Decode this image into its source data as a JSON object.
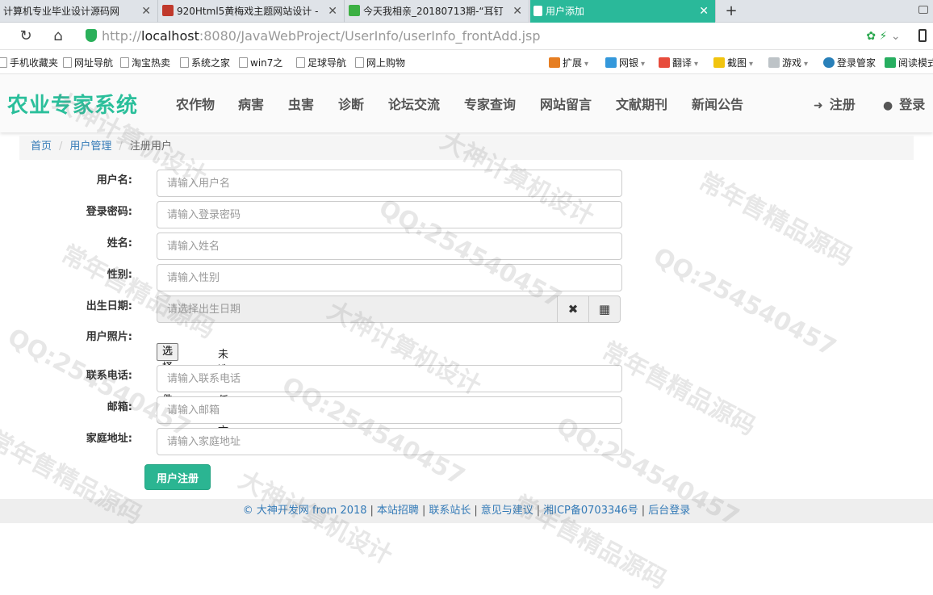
{
  "browser": {
    "tabs": [
      {
        "title": "计算机专业毕业设计源码网",
        "favicon_color": "#e8e8e8"
      },
      {
        "title": "920Html5黄梅戏主题网站设计 -",
        "favicon_color": "#c0392b"
      },
      {
        "title": "今天我相亲_20180713期-“耳钉",
        "favicon_color": "#3cb043"
      },
      {
        "title": "用户添加",
        "favicon_color": "#ffffff"
      }
    ],
    "new_tab_symbol": "+",
    "url_scheme": "http://",
    "url_host": "localhost",
    "url_rest": ":8080/JavaWebProject/UserInfo/userInfo_frontAdd.jsp",
    "bookmarks_left": [
      "手机收藏夹",
      "网址导航",
      "淘宝热卖",
      "系统之家",
      "win7之",
      "足球导航",
      "网上购物"
    ],
    "bookmarks_right": [
      "扩展",
      "网银",
      "翻译",
      "截图",
      "游戏",
      "登录管家",
      "阅读模式"
    ]
  },
  "site": {
    "logo": "农业专家系统",
    "menu": [
      "农作物",
      "病害",
      "虫害",
      "诊断",
      "论坛交流",
      "专家查询",
      "网站留言",
      "文献期刊",
      "新闻公告"
    ],
    "register": "注册",
    "login": "登录"
  },
  "breadcrumb": {
    "home": "首页",
    "section": "用户管理",
    "current": "注册用户"
  },
  "form": {
    "username": {
      "label": "用户名:",
      "placeholder": "请输入用户名"
    },
    "password": {
      "label": "登录密码:",
      "placeholder": "请输入登录密码"
    },
    "name": {
      "label": "姓名:",
      "placeholder": "请输入姓名"
    },
    "gender": {
      "label": "性别:",
      "placeholder": "请输入性别"
    },
    "birthday": {
      "label": "出生日期:",
      "placeholder": "请选择出生日期"
    },
    "photo": {
      "label": "用户照片:",
      "button": "选择文件",
      "status": "未选择任何文件"
    },
    "phone": {
      "label": "联系电话:",
      "placeholder": "请输入联系电话"
    },
    "email": {
      "label": "邮箱:",
      "placeholder": "请输入邮箱"
    },
    "address": {
      "label": "家庭地址:",
      "placeholder": "请输入家庭地址"
    },
    "submit": "用户注册"
  },
  "footer": {
    "copyright": "© 大神开发网 from 2018",
    "links": [
      "本站招聘",
      "联系站长",
      "意见与建议",
      "湘ICP备0703346号",
      "后台登录"
    ]
  },
  "watermarks": [
    "大神计算机设计",
    "常年售精品源码",
    "QQ:254540457"
  ]
}
